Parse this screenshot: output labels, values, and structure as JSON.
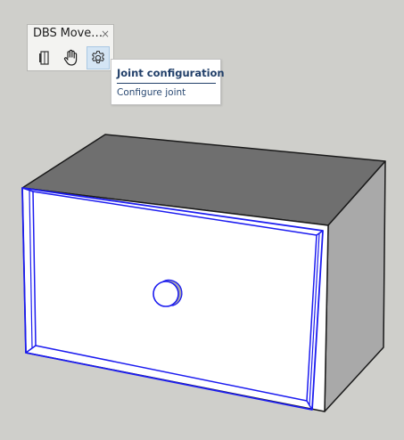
{
  "toolbar": {
    "title": "DBS Move…",
    "close_symbol": "×",
    "buttons": [
      {
        "icon": "door-panel-icon",
        "active": false
      },
      {
        "icon": "hand-icon",
        "active": false
      },
      {
        "icon": "gear-icon",
        "active": true
      }
    ]
  },
  "tooltip": {
    "title": "Joint configuration",
    "description": "Configure joint"
  },
  "colors": {
    "background": "#cfcfcb",
    "selection": "#1c1cf0",
    "tooltip_text": "#22406a",
    "box_top": "#6f6f6f",
    "box_side": "#a9a9a9",
    "box_front": "#ffffff"
  }
}
